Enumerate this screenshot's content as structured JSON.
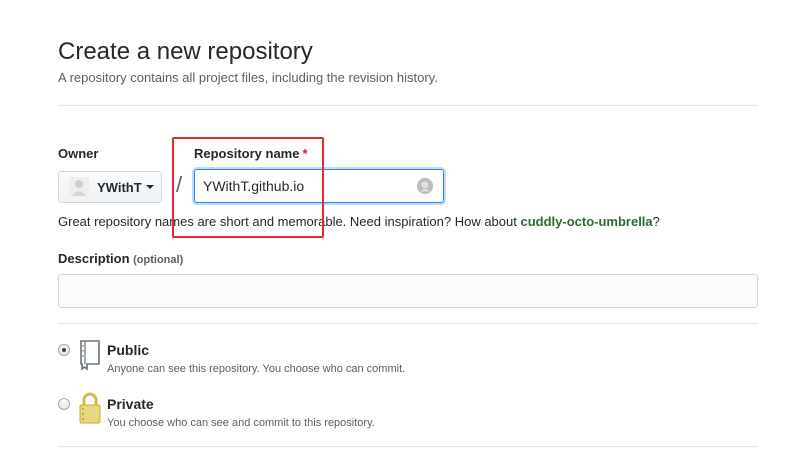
{
  "page": {
    "title": "Create a new repository",
    "subtitle": "A repository contains all project files, including the revision history."
  },
  "owner": {
    "label": "Owner",
    "name": "YWithT"
  },
  "repo_name": {
    "label": "Repository name",
    "required_mark": "*",
    "value": "YWithT.github.io",
    "separator": "/"
  },
  "hint": {
    "text": "Great repository names are short and memorable. Need inspiration? How about ",
    "suggestion": "cuddly-octo-umbrella",
    "suffix": "?"
  },
  "description": {
    "label": "Description",
    "optional": "(optional)",
    "value": ""
  },
  "visibility": {
    "selected": "public",
    "options": [
      {
        "label": "Public",
        "note": "Anyone can see this repository. You choose who can commit.",
        "icon": "repo-icon"
      },
      {
        "label": "Private",
        "note": "You choose who can see and commit to this repository.",
        "icon": "lock-icon"
      }
    ]
  },
  "colors": {
    "focus_border": "#2188ff",
    "required": "#cb2431",
    "suggestion": "#2c6a2f",
    "annotation_box": "#e8282e"
  }
}
